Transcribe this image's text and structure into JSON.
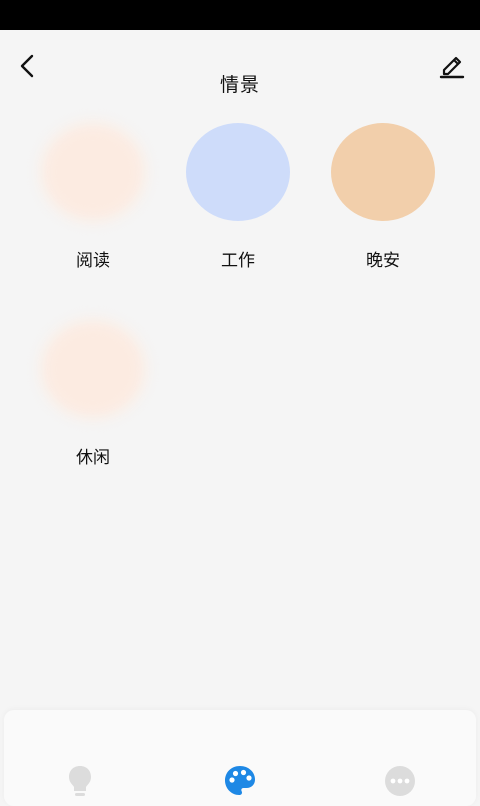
{
  "header": {
    "title": "情景"
  },
  "scenes": [
    {
      "label": "阅读",
      "color": "#fdebe0",
      "style": "soft"
    },
    {
      "label": "工作",
      "color": "#cedcfa",
      "style": "solid"
    },
    {
      "label": "晚安",
      "color": "#f2cfab",
      "style": "solid"
    },
    {
      "label": "休闲",
      "color": "#fdebe0",
      "style": "soft"
    }
  ],
  "bottom_nav": {
    "items": [
      {
        "icon": "lightbulb-icon",
        "color": "#dcdcdc",
        "active": false
      },
      {
        "icon": "palette-icon",
        "color": "#1e88e5",
        "active": true
      },
      {
        "icon": "more-dots-icon",
        "color": "#dcdcdc",
        "active": false
      }
    ]
  }
}
